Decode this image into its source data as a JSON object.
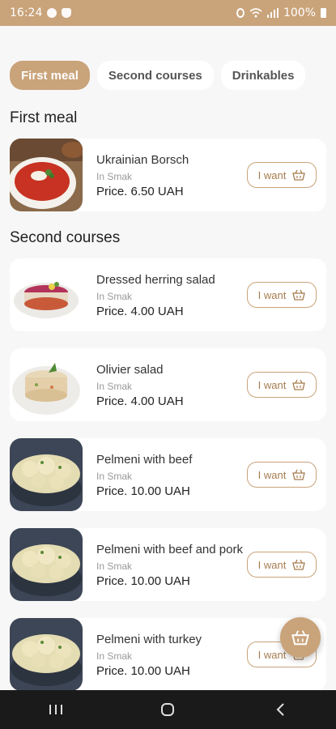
{
  "status_bar": {
    "time": "16:24",
    "battery": "100%",
    "icons": [
      "messenger-icon",
      "shield-icon",
      "alarm-icon",
      "wifi-icon",
      "signal-icon",
      "battery-icon"
    ]
  },
  "tabs": [
    {
      "label": "First meal",
      "active": true
    },
    {
      "label": "Second courses",
      "active": false
    },
    {
      "label": "Drinkables",
      "active": false
    }
  ],
  "sections": [
    {
      "title": "First meal"
    },
    {
      "title": "Second courses"
    }
  ],
  "items": [
    {
      "name": "Ukrainian Borsch",
      "place": "In Smak",
      "price": "Price. 6.50 UAH",
      "button": "I want",
      "image": "borsch-image"
    },
    {
      "name": "Dressed herring salad",
      "place": "In Smak",
      "price": "Price. 4.00 UAH",
      "button": "I want",
      "image": "herring-salad-image"
    },
    {
      "name": "Olivier salad",
      "place": "In Smak",
      "price": "Price. 4.00 UAH",
      "button": "I want",
      "image": "olivier-salad-image"
    },
    {
      "name": "Pelmeni with beef",
      "place": "In Smak",
      "price": "Price. 10.00 UAH",
      "button": "I want",
      "image": "pelmeni-image"
    },
    {
      "name": "Pelmeni with beef and pork",
      "place": "In Smak",
      "price": "Price. 10.00 UAH",
      "button": "I want",
      "image": "pelmeni-image"
    },
    {
      "name": "Pelmeni with turkey",
      "place": "In Smak",
      "price": "Price. 10.00 UAH",
      "button": "I want",
      "image": "pelmeni-image"
    }
  ],
  "colors": {
    "accent": "#c9a37a",
    "background": "#f7f7f7",
    "button_text": "#a67c4f"
  },
  "fab": {
    "icon": "basket-icon"
  },
  "nav": {
    "icons": [
      "recent-apps-icon",
      "home-icon",
      "back-icon"
    ]
  }
}
